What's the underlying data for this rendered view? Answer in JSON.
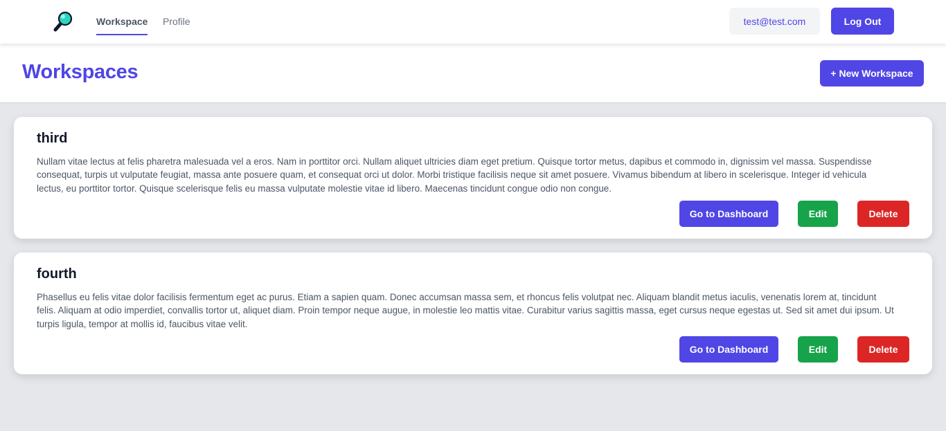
{
  "nav": {
    "logo_icon": "magnifier-icon",
    "tabs": [
      {
        "label": "Workspace",
        "active": true
      },
      {
        "label": "Profile",
        "active": false
      }
    ],
    "user_email": "test@test.com",
    "logout_label": "Log Out"
  },
  "header": {
    "title": "Workspaces",
    "new_button_label": "+ New Workspace"
  },
  "workspaces": [
    {
      "name": "third",
      "description": "Nullam vitae lectus at felis pharetra malesuada vel a eros. Nam in porttitor orci. Nullam aliquet ultricies diam eget pretium. Quisque tortor metus, dapibus et commodo in, dignissim vel massa. Suspendisse consequat, turpis ut vulputate feugiat, massa ante posuere quam, et consequat orci ut dolor. Morbi tristique facilisis neque sit amet posuere. Vivamus bibendum at libero in scelerisque. Integer id vehicula lectus, eu porttitor tortor. Quisque scelerisque felis eu massa vulputate molestie vitae id libero. Maecenas tincidunt congue odio non congue.",
      "dashboard_label": "Go to Dashboard",
      "edit_label": "Edit",
      "delete_label": "Delete"
    },
    {
      "name": "fourth",
      "description": "Phasellus eu felis vitae dolor facilisis fermentum eget ac purus. Etiam a sapien quam. Donec accumsan massa sem, et rhoncus felis volutpat nec. Aliquam blandit metus iaculis, venenatis lorem at, tincidunt felis. Aliquam at odio imperdiet, convallis tortor ut, aliquet diam. Proin tempor neque augue, in molestie leo mattis vitae. Curabitur varius sagittis massa, eget cursus neque egestas ut. Sed sit amet dui ipsum. Ut turpis ligula, tempor at mollis id, faucibus vitae velit.",
      "dashboard_label": "Go to Dashboard",
      "edit_label": "Edit",
      "delete_label": "Delete"
    }
  ],
  "colors": {
    "primary": "#4f46e5",
    "success": "#16a34a",
    "danger": "#dc2626",
    "background": "#e5e7eb"
  }
}
